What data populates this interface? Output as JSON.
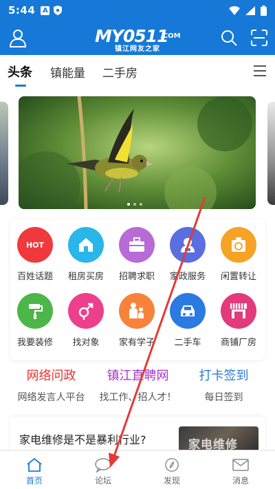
{
  "status_bar": {
    "time": "5:44",
    "icon_a": "A"
  },
  "header": {
    "logo_main": "MY0511",
    "logo_com": ".COM",
    "logo_sub": "镇江网友之家"
  },
  "tabs": [
    {
      "label": "头条",
      "active": true
    },
    {
      "label": "镇能量",
      "active": false
    },
    {
      "label": "二手房",
      "active": false
    }
  ],
  "banner": {
    "page_count": 3,
    "active_index": 1
  },
  "grid": [
    {
      "label": "百姓话题",
      "icon": "hot-icon",
      "color": "#f0393c",
      "badge": "HOT"
    },
    {
      "label": "租房买房",
      "icon": "house-icon",
      "color": "#2ab6e8"
    },
    {
      "label": "招聘求职",
      "icon": "briefcase-icon",
      "color": "#b86ad6"
    },
    {
      "label": "家政服务",
      "icon": "housekeeping-icon",
      "color": "#5a6ee0"
    },
    {
      "label": "闲置转让",
      "icon": "recycle-icon",
      "color": "#f6a325"
    },
    {
      "label": "我要装修",
      "icon": "paint-roller-icon",
      "color": "#4cb648"
    },
    {
      "label": "找对象",
      "icon": "gender-icon",
      "color": "#ee3f8c"
    },
    {
      "label": "家有学子",
      "icon": "family-icon",
      "color": "#f7833a"
    },
    {
      "label": "二手车",
      "icon": "car-icon",
      "color": "#2b7ae2"
    },
    {
      "label": "商铺厂房",
      "icon": "shop-icon",
      "color": "#e23a7b"
    }
  ],
  "links": [
    {
      "title": "网络问政",
      "sub": "网络发言人平台",
      "color": "#e8322f"
    },
    {
      "title": "镇江直聘网",
      "sub": "找工作、招人才！",
      "color": "#a535c9"
    },
    {
      "title": "打卡签到",
      "sub": "每日签到",
      "color": "#2a7ad9"
    }
  ],
  "article": {
    "title": "家电维修是不是暴利行业?",
    "thumb_text": "家电维修"
  },
  "bottom_nav": [
    {
      "label": "首页",
      "icon": "home-icon",
      "active": true
    },
    {
      "label": "论坛",
      "icon": "chat-bubble-icon",
      "active": false
    },
    {
      "label": "发现",
      "icon": "compass-icon",
      "active": false
    },
    {
      "label": "消息",
      "icon": "mail-icon",
      "active": false
    }
  ],
  "colors": {
    "primary": "#1679d8",
    "annotation_arrow": "#e53935"
  }
}
